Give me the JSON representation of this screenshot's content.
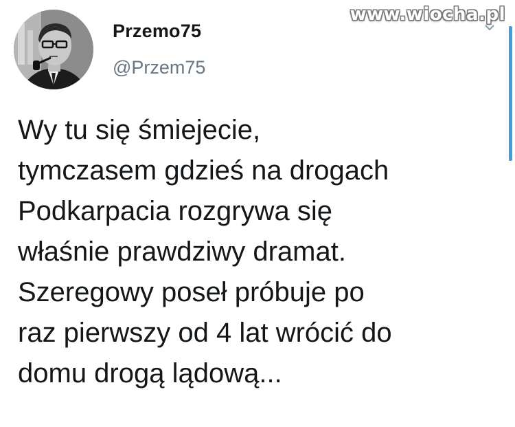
{
  "watermark": "www.wiocha.pl",
  "author": {
    "display_name": "Przemo75",
    "handle": "@Przem75",
    "avatar_icon": "profile-photo-man-with-pipe"
  },
  "tweet": {
    "lines": [
      "Wy tu się śmiejecie,",
      "tymczasem gdzieś na drogach",
      "Podkarpacia rozgrywa się",
      "właśnie prawdziwy dramat.",
      "Szeregowy poseł próbuje po",
      "raz pierwszy od 4 lat wrócić do",
      "domu drogą lądową..."
    ]
  },
  "colors": {
    "handle": "#657786",
    "text": "#14171a",
    "scrollbar": "#3d9de0"
  }
}
